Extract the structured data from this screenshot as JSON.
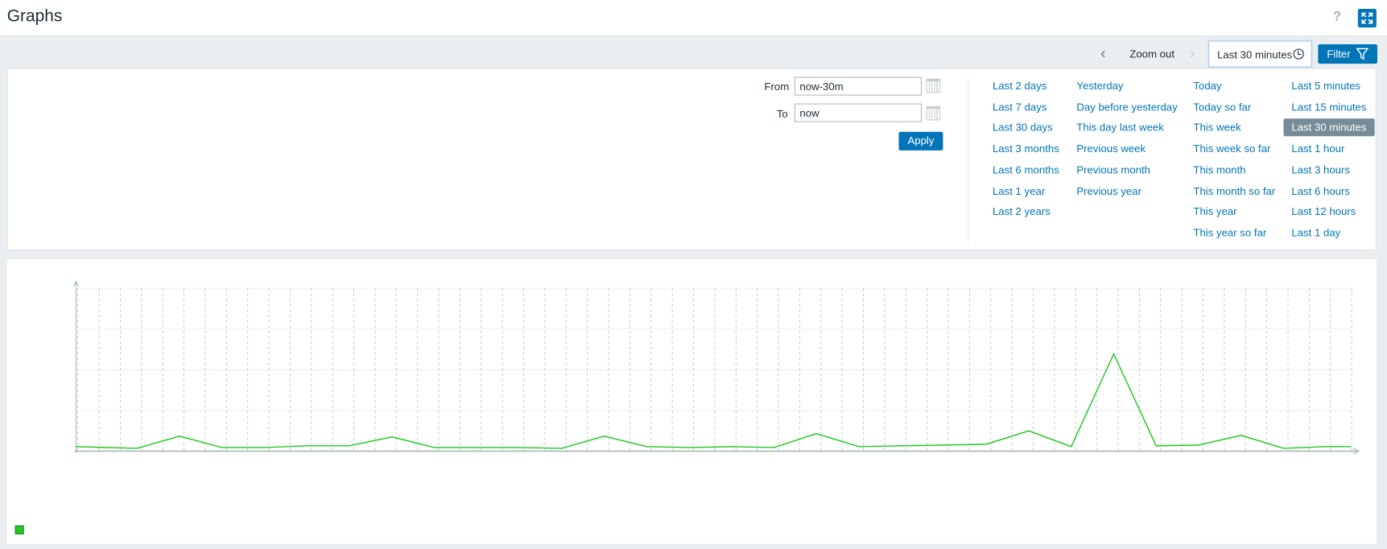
{
  "header": {
    "title": "Graphs",
    "help_icon": "question-icon",
    "fullscreen_icon": "fullscreen-icon",
    "accent": "#0275b8"
  },
  "toolbar": {
    "zoom_out": "Zoom out",
    "time_range": "Last 30 minutes",
    "filter": "Filter"
  },
  "filter": {
    "from_label": "From",
    "from_value": "now-30m",
    "to_label": "To",
    "to_value": "now",
    "apply": "Apply",
    "quick_ranges": [
      [
        "Last 2 days",
        "Last 7 days",
        "Last 30 days",
        "Last 3 months",
        "Last 6 months",
        "Last 1 year",
        "Last 2 years"
      ],
      [
        "Yesterday",
        "Day before yesterday",
        "This day last week",
        "Previous week",
        "Previous month",
        "Previous year"
      ],
      [
        "Today",
        "Today so far",
        "This week",
        "This week so far",
        "This month",
        "This month so far",
        "This year",
        "This year so far"
      ],
      [
        "Last 5 minutes",
        "Last 15 minutes",
        "Last 30 minutes",
        "Last 1 hour",
        "Last 3 hours",
        "Last 6 hours",
        "Last 12 hours",
        "Last 1 day"
      ]
    ],
    "selected": "Last 30 minutes"
  },
  "chart_data": {
    "type": "line",
    "title": "",
    "xlabel": "",
    "ylabel": "",
    "ylim": [
      0,
      4
    ],
    "grid": true,
    "legend": "bottom-left",
    "series": [
      {
        "color": "#1ec81e",
        "values": [
          0.11,
          0.07,
          0.37,
          0.09,
          0.09,
          0.13,
          0.13,
          0.35,
          0.09,
          0.09,
          0.09,
          0.07,
          0.37,
          0.11,
          0.09,
          0.11,
          0.09,
          0.43,
          0.11,
          0.13,
          0.15,
          0.17,
          0.5,
          0.11,
          2.39,
          0.13,
          0.15,
          0.39,
          0.07,
          0.11,
          0.11
        ]
      }
    ]
  }
}
